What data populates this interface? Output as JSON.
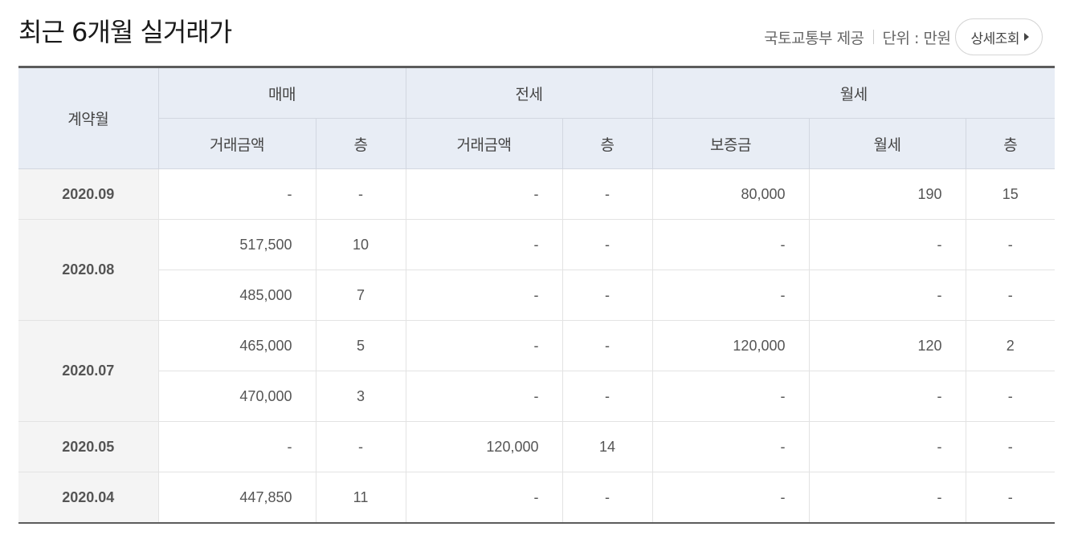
{
  "header": {
    "title": "최근 6개월 실거래가",
    "source": "국토교통부 제공",
    "unit": "단위 : 만원",
    "detail_button": "상세조회"
  },
  "table": {
    "headers": {
      "contract_month": "계약월",
      "sale": "매매",
      "jeonse": "전세",
      "monthly": "월세",
      "sale_amount": "거래금액",
      "sale_floor": "층",
      "jeonse_amount": "거래금액",
      "jeonse_floor": "층",
      "deposit": "보증금",
      "monthly_rent": "월세",
      "monthly_floor": "층"
    },
    "groups": [
      {
        "month": "2020.09",
        "rows": [
          {
            "sale_amount": "-",
            "sale_floor": "-",
            "jeonse_amount": "-",
            "jeonse_floor": "-",
            "deposit": "80,000",
            "monthly_rent": "190",
            "monthly_floor": "15"
          }
        ]
      },
      {
        "month": "2020.08",
        "rows": [
          {
            "sale_amount": "517,500",
            "sale_floor": "10",
            "jeonse_amount": "-",
            "jeonse_floor": "-",
            "deposit": "-",
            "monthly_rent": "-",
            "monthly_floor": "-"
          },
          {
            "sale_amount": "485,000",
            "sale_floor": "7",
            "jeonse_amount": "-",
            "jeonse_floor": "-",
            "deposit": "-",
            "monthly_rent": "-",
            "monthly_floor": "-"
          }
        ]
      },
      {
        "month": "2020.07",
        "rows": [
          {
            "sale_amount": "465,000",
            "sale_floor": "5",
            "jeonse_amount": "-",
            "jeonse_floor": "-",
            "deposit": "120,000",
            "monthly_rent": "120",
            "monthly_floor": "2"
          },
          {
            "sale_amount": "470,000",
            "sale_floor": "3",
            "jeonse_amount": "-",
            "jeonse_floor": "-",
            "deposit": "-",
            "monthly_rent": "-",
            "monthly_floor": "-"
          }
        ]
      },
      {
        "month": "2020.05",
        "rows": [
          {
            "sale_amount": "-",
            "sale_floor": "-",
            "jeonse_amount": "120,000",
            "jeonse_floor": "14",
            "deposit": "-",
            "monthly_rent": "-",
            "monthly_floor": "-"
          }
        ]
      },
      {
        "month": "2020.04",
        "rows": [
          {
            "sale_amount": "447,850",
            "sale_floor": "11",
            "jeonse_amount": "-",
            "jeonse_floor": "-",
            "deposit": "-",
            "monthly_rent": "-",
            "monthly_floor": "-"
          }
        ]
      }
    ]
  }
}
